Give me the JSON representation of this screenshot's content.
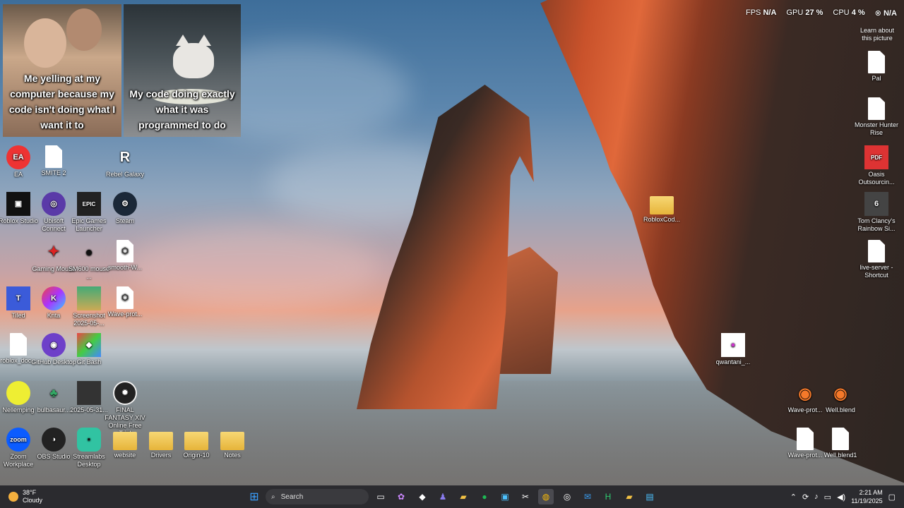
{
  "meme": {
    "left_caption": "Me yelling at my computer because my code isn't doing what I want it to",
    "right_caption": "My code doing exactly what it was programmed to do"
  },
  "perf": {
    "fps_label": "FPS",
    "fps_value": "N/A",
    "gpu_label": "GPU",
    "gpu_value": "27 %",
    "cpu_label": "CPU",
    "cpu_value": "4 %",
    "extra_value": "N/A"
  },
  "learn_picture": "Learn about this picture",
  "icons_left": [
    {
      "label": "EA",
      "icon": "ea-icon"
    },
    {
      "label": "SMITE 2",
      "icon": "file-icon"
    },
    {
      "label": "Rebel Galaxy",
      "icon": "rebel-galaxy-icon"
    },
    {
      "label": "Roblox Studio",
      "icon": "roblox-studio-icon"
    },
    {
      "label": "Ubisoft Connect",
      "icon": "ubisoft-icon"
    },
    {
      "label": "Epic Games Launcher",
      "icon": "epic-games-icon"
    },
    {
      "label": "Steam",
      "icon": "steam-icon"
    },
    {
      "label": "Gaming Mouse",
      "icon": "gaming-mouse-icon"
    },
    {
      "label": "SM600 mouse ...",
      "icon": "mouse-icon"
    },
    {
      "label": "smooth-W...",
      "icon": "cube-file-icon"
    },
    {
      "label": "Tiled",
      "icon": "tiled-icon"
    },
    {
      "label": "Krita",
      "icon": "krita-icon"
    },
    {
      "label": "Screenshot 2025-05-...",
      "icon": "image-icon"
    },
    {
      "label": "Wave-prot...",
      "icon": "cube-file-icon"
    },
    {
      "label": "roblox_doc...",
      "icon": "file-icon"
    },
    {
      "label": "GitHub Desktop",
      "icon": "github-icon"
    },
    {
      "label": "Git Bash",
      "icon": "git-icon"
    },
    {
      "label": "Nellemping",
      "icon": "image-icon"
    },
    {
      "label": "bulbasaur...",
      "icon": "image-icon"
    },
    {
      "label": "2025-05-31...",
      "icon": "image-icon"
    },
    {
      "label": "FINAL FANTASY XIV Online Free Trial",
      "icon": "ffxiv-icon"
    },
    {
      "label": "Zoom Workplace",
      "icon": "zoom-icon"
    },
    {
      "label": "OBS Studio",
      "icon": "obs-icon"
    },
    {
      "label": "Streamlabs Desktop",
      "icon": "streamlabs-icon"
    },
    {
      "label": "website",
      "icon": "folder-icon"
    },
    {
      "label": "Drivers",
      "icon": "folder-icon"
    },
    {
      "label": "Origin-10",
      "icon": "folder-icon"
    },
    {
      "label": "Notes",
      "icon": "folder-icon"
    }
  ],
  "icons_right": [
    {
      "label": "Pal",
      "icon": "file-icon"
    },
    {
      "label": "Monster Hunter Rise",
      "icon": "file-icon"
    },
    {
      "label": "Oasis Outsourcin...",
      "icon": "pdf-icon"
    },
    {
      "label": "Tom Clancy's Rainbow Si...",
      "icon": "rainbow-six-icon"
    },
    {
      "label": "live-server - Shortcut",
      "icon": "file-icon"
    },
    {
      "label": "RobloxCod...",
      "icon": "folder-icon"
    },
    {
      "label": "qwantani_...",
      "icon": "image-icon"
    },
    {
      "label": "Wave-prot...",
      "icon": "blender-icon"
    },
    {
      "label": "Well.blend",
      "icon": "blender-icon"
    },
    {
      "label": "Wave-prot...",
      "icon": "file-icon"
    },
    {
      "label": "Well.blend1",
      "icon": "file-icon"
    }
  ],
  "taskbar": {
    "weather_temp": "38°F",
    "weather_desc": "Cloudy",
    "search_placeholder": "Search",
    "time": "2:21 AM",
    "date": "11/19/2025"
  },
  "colors": {
    "accent": "#0078d4",
    "taskbar_bg": "#202024"
  }
}
